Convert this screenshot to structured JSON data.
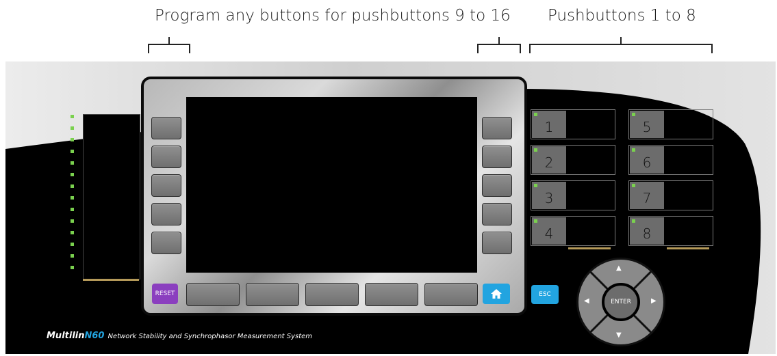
{
  "callouts": {
    "left": "Program any buttons for pushbuttons 9 to 16",
    "right": "Pushbuttons 1 to 8"
  },
  "buttons": {
    "reset": "RESET",
    "esc": "ESC",
    "enter": "ENTER"
  },
  "pushbuttons": [
    "1",
    "2",
    "3",
    "4",
    "5",
    "6",
    "7",
    "8"
  ],
  "brand": {
    "name": "Multilin",
    "model": "N60",
    "description": "Network Stability and Synchrophasor Measurement System"
  },
  "icons": {
    "home": "home-icon",
    "up": "arrow-up-icon",
    "down": "arrow-down-icon",
    "left": "arrow-left-icon",
    "right": "arrow-right-icon"
  },
  "colors": {
    "led": "#7ad14e",
    "reset": "#8b3fbf",
    "accent": "#22a4e0",
    "bar": "#b59a5a"
  }
}
